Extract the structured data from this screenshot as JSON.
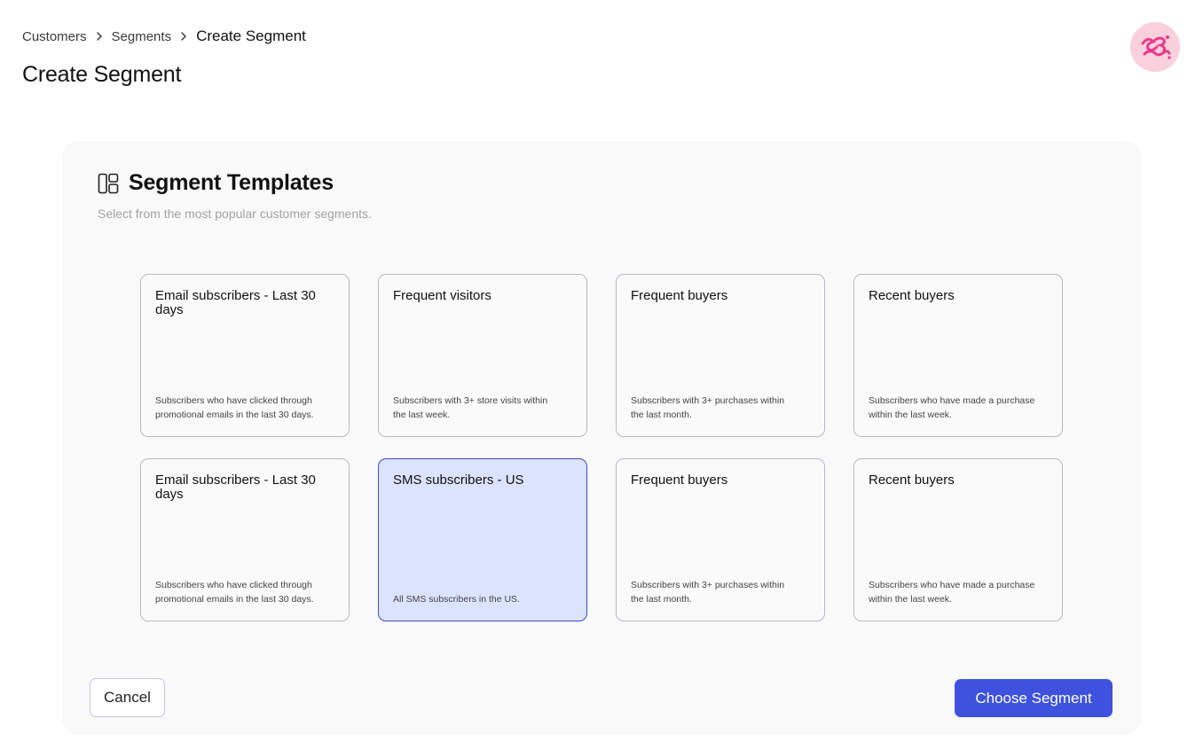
{
  "breadcrumb": {
    "items": [
      "Customers",
      "Segments"
    ],
    "current": "Create Segment"
  },
  "page_title": "Create Segment",
  "avatar": {
    "brand_text": "Candi Rose",
    "background": "#f9d0dc",
    "text_color": "#e83a8c"
  },
  "panel": {
    "icon": "templates-icon",
    "title": "Segment Templates",
    "subtitle": "Select from the most popular customer segments."
  },
  "templates": [
    {
      "title": "Email subscribers - Last 30 days",
      "description": "Subscribers who have clicked through promotional emails in the last 30 days.",
      "selected": false
    },
    {
      "title": "Frequent visitors",
      "description": "Subscribers with 3+ store visits within the last week.",
      "selected": false
    },
    {
      "title": "Frequent buyers",
      "description": "Subscribers with 3+ purchases within the last month.",
      "selected": false
    },
    {
      "title": "Recent buyers",
      "description": "Subscribers who have made a purchase within the last week.",
      "selected": false
    },
    {
      "title": "Email subscribers - Last 30 days",
      "description": "Subscribers who have clicked through promotional emails in the last 30 days.",
      "selected": false
    },
    {
      "title": "SMS subscribers - US",
      "description": "All SMS subscribers in the US.",
      "selected": true
    },
    {
      "title": "Frequent buyers",
      "description": "Subscribers with 3+ purchases within the last month.",
      "selected": false
    },
    {
      "title": "Recent buyers",
      "description": "Subscribers who have made a purchase within the last week.",
      "selected": false
    }
  ],
  "actions": {
    "cancel_label": "Cancel",
    "choose_label": "Choose Segment"
  },
  "colors": {
    "accent": "#3e52dd",
    "selected_card_bg": "#dbe3ff",
    "selected_card_border": "#3b4bc8"
  }
}
